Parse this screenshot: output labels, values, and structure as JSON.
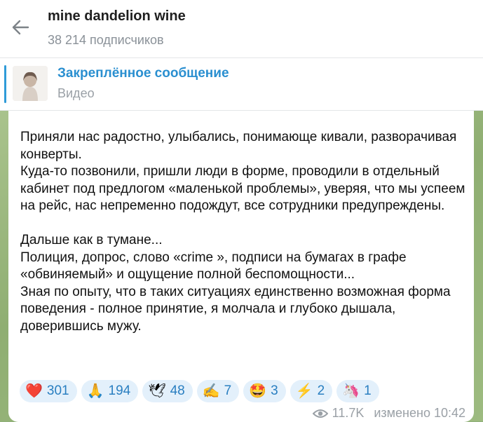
{
  "header": {
    "title": "mine dandelion wine",
    "subtitle": "38 214 подписчиков"
  },
  "pinned": {
    "title": "Закреплённое сообщение",
    "subtitle": "Видео"
  },
  "message": {
    "text": "Приняли нас радостно, улыбались, понимающе кивали, разворачивая конверты.\nКуда-то позвонили, пришли люди в форме, проводили в отдельный кабинет под предлогом «маленькой проблемы», уверяя, что мы успеем на рейс, нас непременно подождут, все сотрудники предупреждены.\n\nДальше как в тумане...\nПолиция, допрос, слово «crime »,  подписи на бумагах в графе «обвиняемый» и ощущение полной беспомощности...\nЗная по опыту, что в таких ситуациях единственно возможная форма поведения  - полное принятие, я молчала и глубоко дышала, доверившись мужу.",
    "views": "11.7K",
    "edited_time": "изменено 10:42"
  },
  "reactions": [
    {
      "emoji": "❤️",
      "icon": "heart-icon",
      "count": "301"
    },
    {
      "emoji": "🙏",
      "icon": "folded-hands-icon",
      "count": "194"
    },
    {
      "emoji": "🕊",
      "icon": "dove-icon",
      "count": "48"
    },
    {
      "emoji": "✍",
      "icon": "writing-hand-icon",
      "count": "7"
    },
    {
      "emoji": "🤩",
      "icon": "star-struck-icon",
      "count": "3"
    },
    {
      "emoji": "⚡",
      "icon": "lightning-icon",
      "count": "2"
    },
    {
      "emoji": "🦄",
      "icon": "unicorn-icon",
      "count": "1"
    }
  ],
  "colors": {
    "accent": "#2a8fd0",
    "reaction_bg": "#e3f0fb",
    "reaction_count": "#2a7fc1",
    "chat_bg": "#9dbb80"
  }
}
